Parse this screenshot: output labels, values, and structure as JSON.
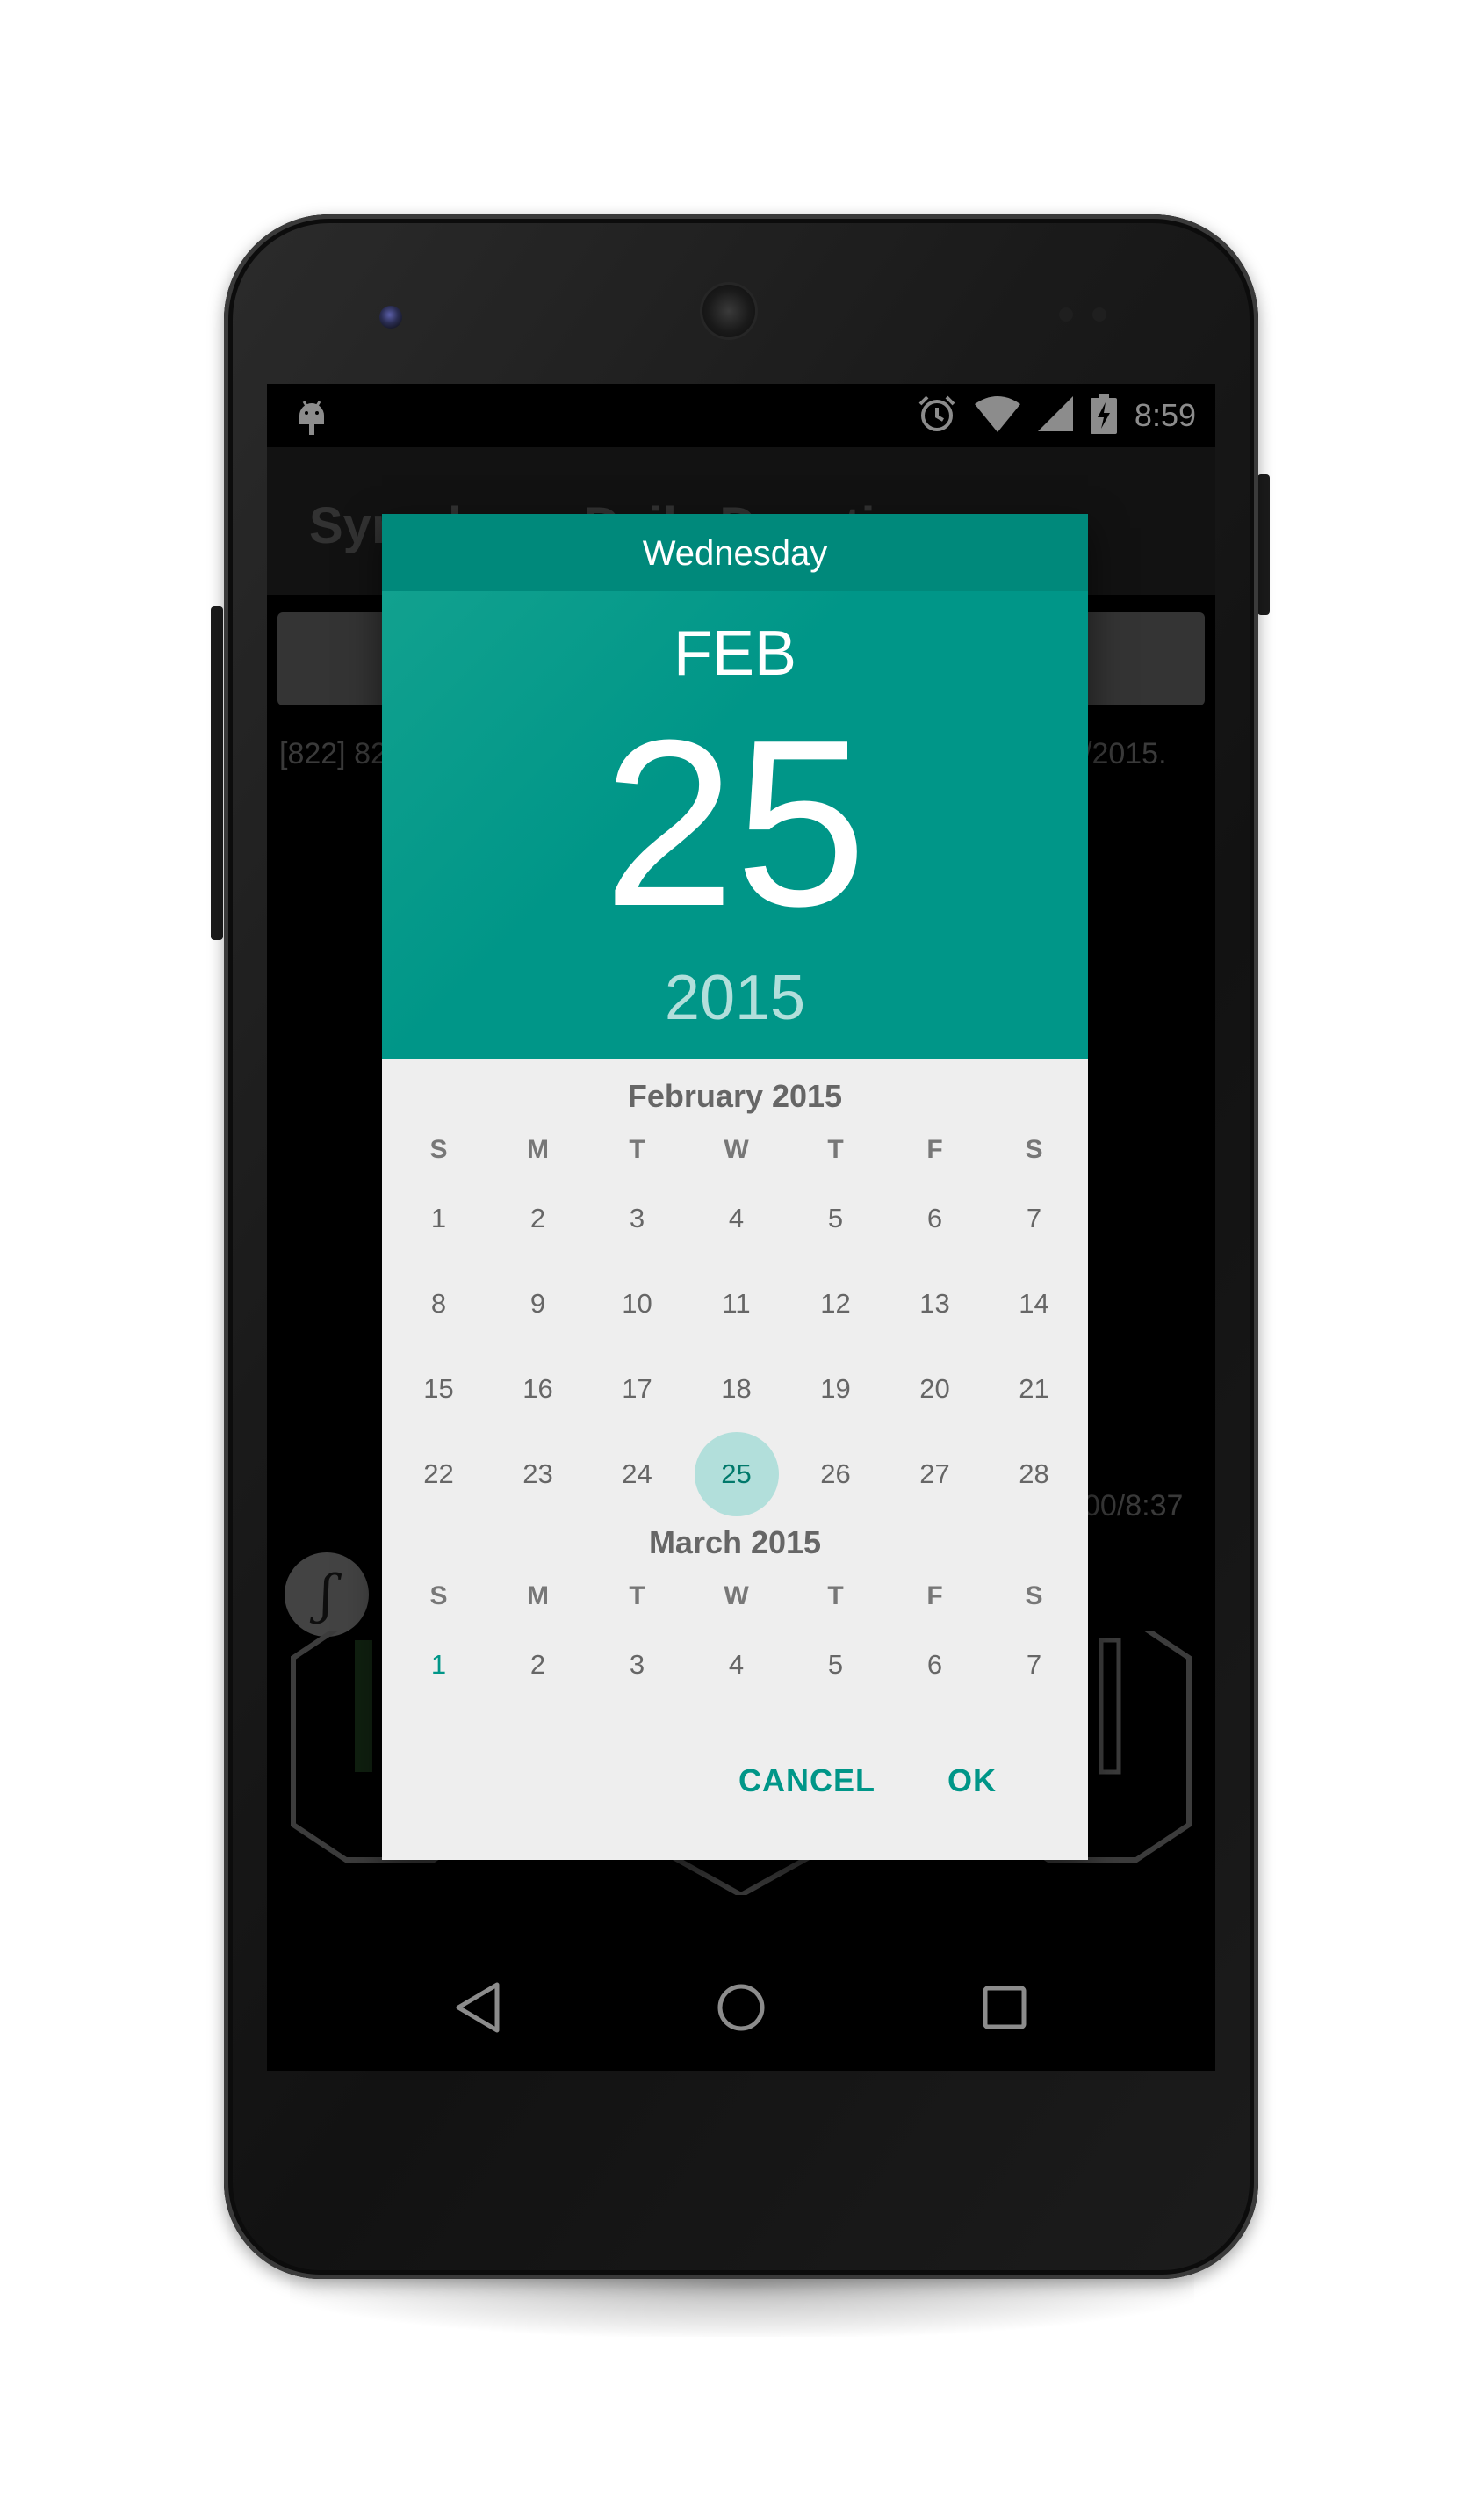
{
  "status_bar": {
    "time": "8:59",
    "icons": [
      "android-debug-icon",
      "alarm-icon",
      "wifi-icon",
      "cell-signal-icon",
      "battery-charging-icon"
    ]
  },
  "app": {
    "title": "Symphony Daily Devotions",
    "text_left": "[822] 82",
    "text_right": "/2015.",
    "progress_text": "00/8:37",
    "logo_glyph": "ʃ"
  },
  "dialog": {
    "day_name": "Wednesday",
    "month_short": "FEB",
    "day": "25",
    "year": "2015",
    "selected_day": 25,
    "weekday_headers": [
      "S",
      "M",
      "T",
      "W",
      "T",
      "F",
      "S"
    ],
    "months": [
      {
        "title": "February 2015",
        "weeks": [
          [
            "1",
            "2",
            "3",
            "4",
            "5",
            "6",
            "7"
          ],
          [
            "8",
            "9",
            "10",
            "11",
            "12",
            "13",
            "14"
          ],
          [
            "15",
            "16",
            "17",
            "18",
            "19",
            "20",
            "21"
          ],
          [
            "22",
            "23",
            "24",
            "25",
            "26",
            "27",
            "28"
          ]
        ]
      },
      {
        "title": "March 2015",
        "weeks": [
          [
            "1",
            "2",
            "3",
            "4",
            "5",
            "6",
            "7"
          ]
        ]
      }
    ],
    "cancel_label": "CANCEL",
    "ok_label": "OK"
  },
  "colors": {
    "accent": "#009688",
    "accent_dark": "#00897b",
    "selected_circle": "#b2dfdb",
    "dialog_bg": "#eeeeee"
  },
  "nav_bar": {
    "icons": [
      "back-icon",
      "home-icon",
      "recents-icon"
    ]
  }
}
